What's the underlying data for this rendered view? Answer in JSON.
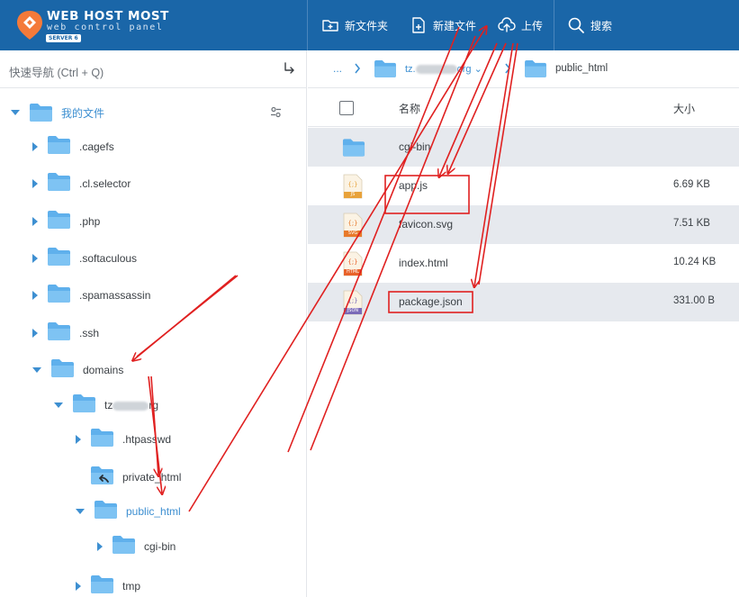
{
  "brand": {
    "name": "WEB HOST MOST",
    "tagline": "web control panel",
    "server": "SERVER 6"
  },
  "toolbar": {
    "new_folder_label": "新文件夹",
    "new_file_label": "新建文件",
    "upload_label": "上传",
    "search_label": "搜索"
  },
  "sidebar": {
    "quicknav_placeholder": "快速导航 (Ctrl + Q)",
    "root_label": "我的文件",
    "items": [
      {
        "label": ".cagefs"
      },
      {
        "label": ".cl.selector"
      },
      {
        "label": ".php"
      },
      {
        "label": ".softaculous"
      },
      {
        "label": ".spamassassin"
      },
      {
        "label": ".ssh"
      },
      {
        "label": "domains"
      },
      {
        "label_prefix": "tz",
        "label_suffix": "rg"
      },
      {
        "label": ".htpasswd"
      },
      {
        "label": "private_html"
      },
      {
        "label": "public_html"
      },
      {
        "label": "cgi-bin"
      },
      {
        "label": "tmp"
      }
    ]
  },
  "breadcrumb": {
    "ellipsis": "...",
    "domain_prefix": "tz.",
    "domain_suffix": "org",
    "current": "public_html"
  },
  "file_list": {
    "header_name": "名称",
    "header_size": "大小",
    "rows": [
      {
        "name": "cgi-bin",
        "size": "",
        "type": "folder"
      },
      {
        "name": "app.js",
        "size": "6.69 KB",
        "type": "js"
      },
      {
        "name": "favicon.svg",
        "size": "7.51 KB",
        "type": "svg"
      },
      {
        "name": "index.html",
        "size": "10.24 KB",
        "type": "html"
      },
      {
        "name": "package.json",
        "size": "331.00 B",
        "type": "json"
      }
    ]
  },
  "icon_texts": {
    "js": "JS",
    "svg": "SVG",
    "html": "HTML",
    "json": "JSON"
  },
  "colors": {
    "topbar": "#1a66a8",
    "accent": "#3d8fd1",
    "folder": "#5fb0ec",
    "row_shade": "#e6e9ee",
    "annotation": "#e02020"
  }
}
